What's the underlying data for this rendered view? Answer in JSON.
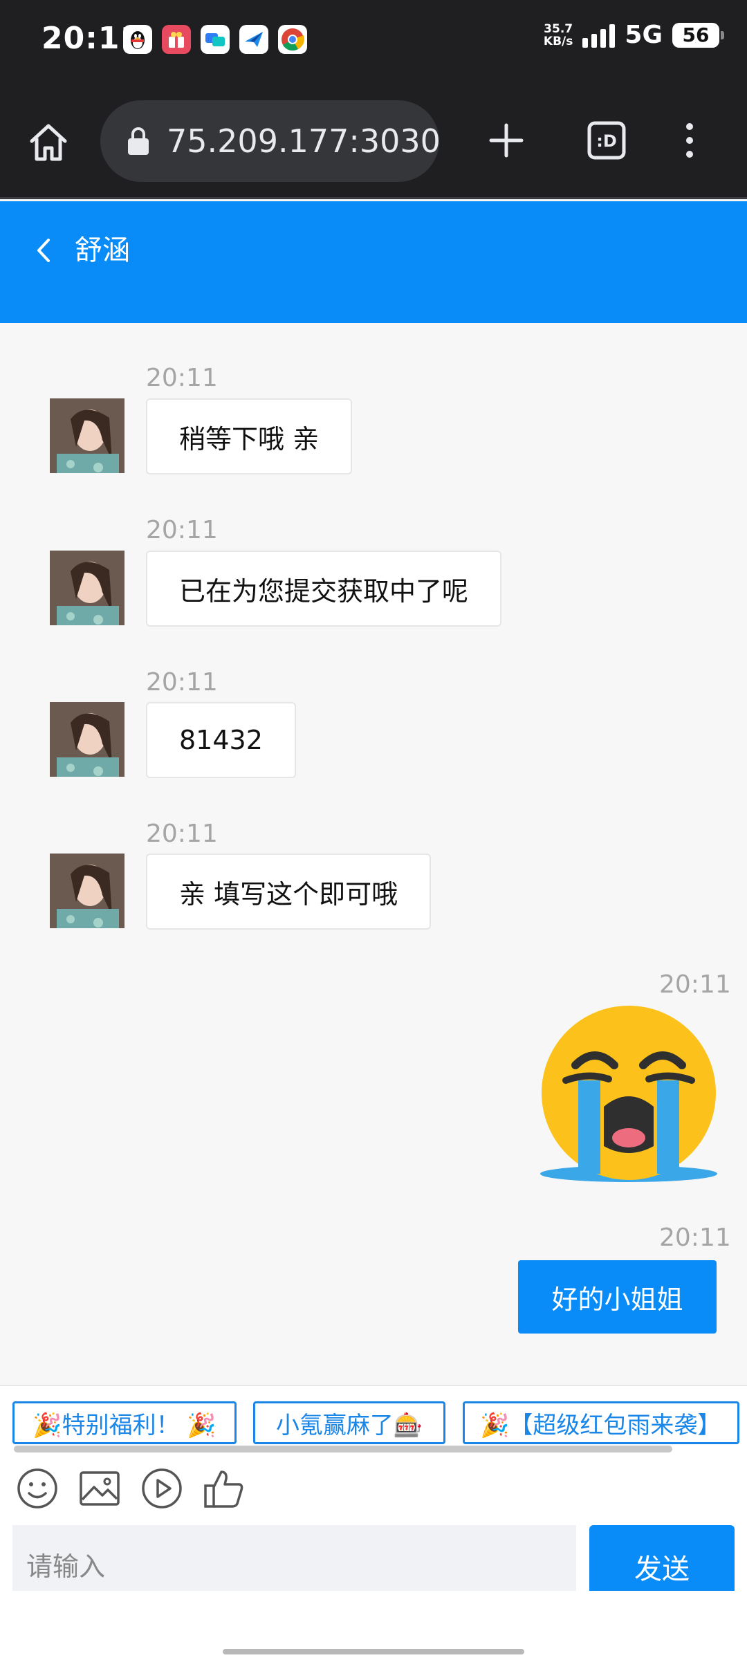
{
  "status": {
    "time": "20:11",
    "net_speed_value": "35.7",
    "net_speed_unit": "KB/s",
    "network": "5G",
    "battery": "56",
    "apps": [
      {
        "name": "qq-icon",
        "label": "",
        "color": "#ffffff"
      },
      {
        "name": "gift-app-icon",
        "label": "",
        "color": "#e84a5f"
      },
      {
        "name": "meeting-app-icon",
        "label": "",
        "color": "#2f7ef5"
      },
      {
        "name": "mail-app-icon",
        "label": "",
        "color": "#1e88e5"
      },
      {
        "name": "chrome-icon",
        "label": "",
        "color": "#ffffff"
      }
    ]
  },
  "browser": {
    "url": "75.209.177:3030"
  },
  "header": {
    "title": "舒涵"
  },
  "messages": [
    {
      "side": "left",
      "time": "20:11",
      "text": "稍等下哦 亲"
    },
    {
      "side": "left",
      "time": "20:11",
      "text": "已在为您提交获取中了呢"
    },
    {
      "side": "left",
      "time": "20:11",
      "text": "81432"
    },
    {
      "side": "left",
      "time": "20:11",
      "text": "亲 填写这个即可哦"
    },
    {
      "side": "right",
      "time": "20:11",
      "type": "emoji",
      "emoji": "loudly-crying-face"
    },
    {
      "side": "right",
      "time": "20:11",
      "text": "好的小姐姐"
    }
  ],
  "promos": [
    "🎉特别福利！ 🎉",
    "小氪赢麻了🎰",
    "🎉【超级红包雨来袭】"
  ],
  "toolbar": {
    "icons": [
      "emoji-icon",
      "image-icon",
      "video-icon",
      "thumbs-up-icon"
    ],
    "input_placeholder": "请输入",
    "send_label": "发送"
  },
  "colors": {
    "primary": "#0a8cf8",
    "chip_border": "#1a86e8"
  }
}
